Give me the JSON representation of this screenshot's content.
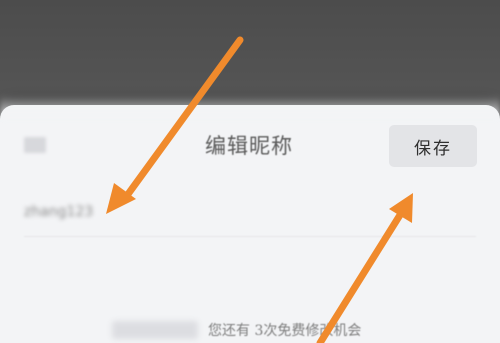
{
  "dialog": {
    "title": "编辑昵称",
    "save_label": "保存",
    "nickname_value": "zhang123",
    "hint": "您还有 3次免费修改机会"
  },
  "icons": {
    "close": "close-icon",
    "arrows": [
      "annotation-arrow-to-input",
      "annotation-arrow-to-save"
    ]
  },
  "colors": {
    "overlay": "#505050",
    "sheet": "#f3f4f6",
    "save_button_bg": "#e3e4e7",
    "annotation_arrow": "#f08a2c"
  }
}
